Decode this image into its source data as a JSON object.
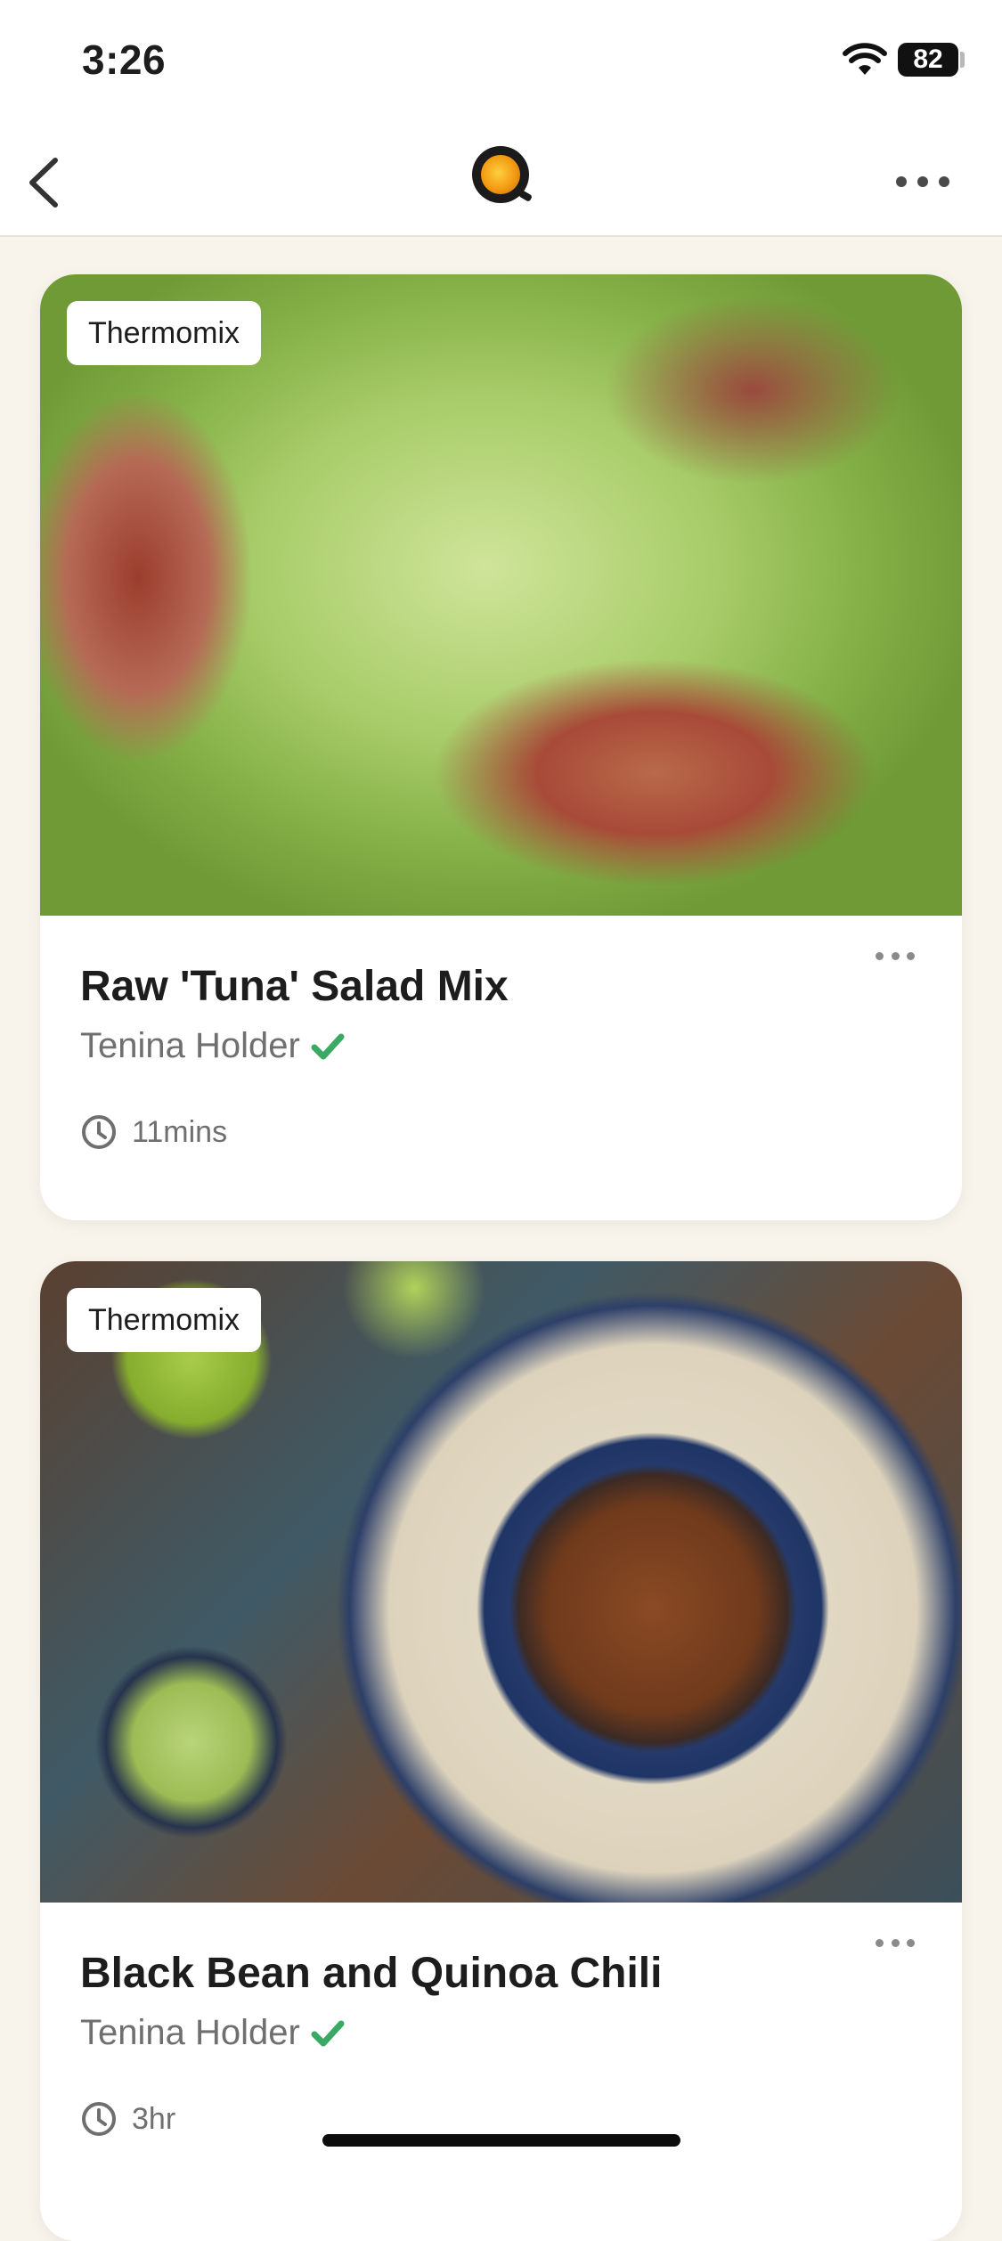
{
  "status_bar": {
    "time": "3:26",
    "battery": "82"
  },
  "nav": {
    "back_icon": "chevron-left-icon",
    "logo_icon": "app-logo-icon",
    "more_icon": "ellipsis-icon"
  },
  "recipes": [
    {
      "tag": "Thermomix",
      "title": "Raw 'Tuna' Salad Mix",
      "author": "Tenina Holder",
      "verified": true,
      "duration": "11mins",
      "image": "lettuce-cups-with-raw-tuna-salad"
    },
    {
      "tag": "Thermomix",
      "title": "Black Bean and Quinoa Chili",
      "author": "Tenina Holder",
      "verified": true,
      "duration": "3hr",
      "image": "bowl-of-chili-with-avocado-and-limes"
    }
  ],
  "colors": {
    "background": "#f8f4ec",
    "card": "#ffffff",
    "verified_green": "#3aa963",
    "text_primary": "#1d1d1d",
    "text_secondary": "#6f6f6f"
  }
}
